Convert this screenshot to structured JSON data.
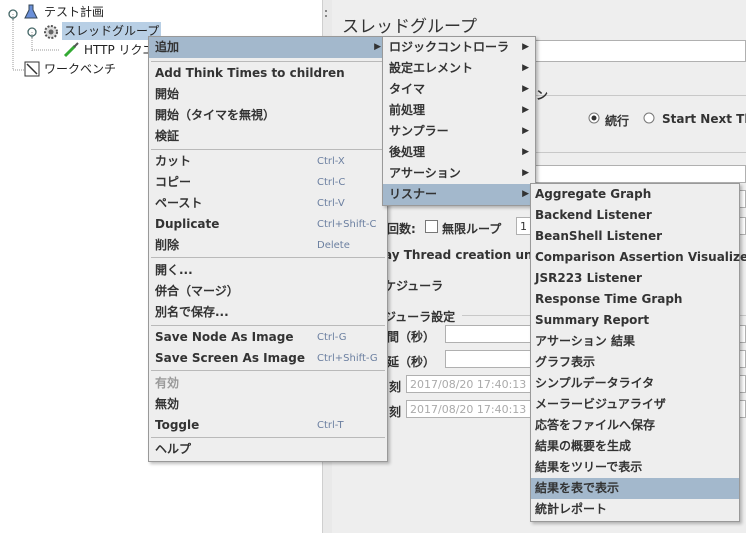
{
  "tree": {
    "test_plan": "テスト計画",
    "thread_group": "スレッドグループ",
    "http_request": "HTTP リクエ",
    "workbench": "ワークベンチ"
  },
  "panel": {
    "title": "スレッドグループ",
    "action_partial": "ン",
    "continue_label": "続行",
    "start_next_label": "Start Next Threa",
    "loop_label": "回数:",
    "infinite_label": "無限ループ",
    "loop_value": "1",
    "delay_text": "ay Thread creation until ne",
    "scheduler_label": "ケジューラ",
    "scheduler_settings": "ジューラ設定",
    "duration_label": "間（秒）",
    "delay_label": "延（秒）",
    "start_time_label": "刻",
    "start_time_value": "2017/08/20 17:40:13",
    "end_time_label": "刻",
    "end_time_value": "2017/08/20 17:40:13"
  },
  "context_menu": {
    "add": "追加",
    "add_think_times": "Add Think Times to children",
    "start": "開始",
    "start_no_timers": "開始（タイマを無視）",
    "validate": "検証",
    "cut": "カット",
    "cut_acc": "Ctrl-X",
    "copy": "コピー",
    "copy_acc": "Ctrl-C",
    "paste": "ペースト",
    "paste_acc": "Ctrl-V",
    "duplicate": "Duplicate",
    "duplicate_acc": "Ctrl+Shift-C",
    "delete": "削除",
    "delete_acc": "Delete",
    "open": "開く...",
    "merge": "併合（マージ）",
    "save_as": "別名で保存...",
    "save_node_image": "Save Node As Image",
    "save_node_image_acc": "Ctrl-G",
    "save_screen_image": "Save Screen As Image",
    "save_screen_image_acc": "Ctrl+Shift-G",
    "enable": "有効",
    "disable": "無効",
    "toggle": "Toggle",
    "toggle_acc": "Ctrl-T",
    "help": "ヘルプ"
  },
  "add_submenu": {
    "logic_controller": "ロジックコントローラ",
    "config_element": "設定エレメント",
    "timer": "タイマ",
    "pre_processor": "前処理",
    "sampler": "サンプラー",
    "post_processor": "後処理",
    "assertion": "アサーション",
    "listener": "リスナー"
  },
  "listener_submenu": [
    "Aggregate Graph",
    "Backend Listener",
    "BeanShell Listener",
    "Comparison Assertion Visualizer",
    "JSR223 Listener",
    "Response Time Graph",
    "Summary Report",
    "アサーション 結果",
    "グラフ表示",
    "シンプルデータライタ",
    "メーラービジュアライザ",
    "応答をファイルへ保存",
    "結果の概要を生成",
    "結果をツリーで表示",
    "結果を表で表示",
    "統計レポート"
  ],
  "colors": {
    "highlight": "#a3b8cc",
    "tree_selection": "#b8cfe5",
    "accelerator": "#6b7fa0"
  }
}
